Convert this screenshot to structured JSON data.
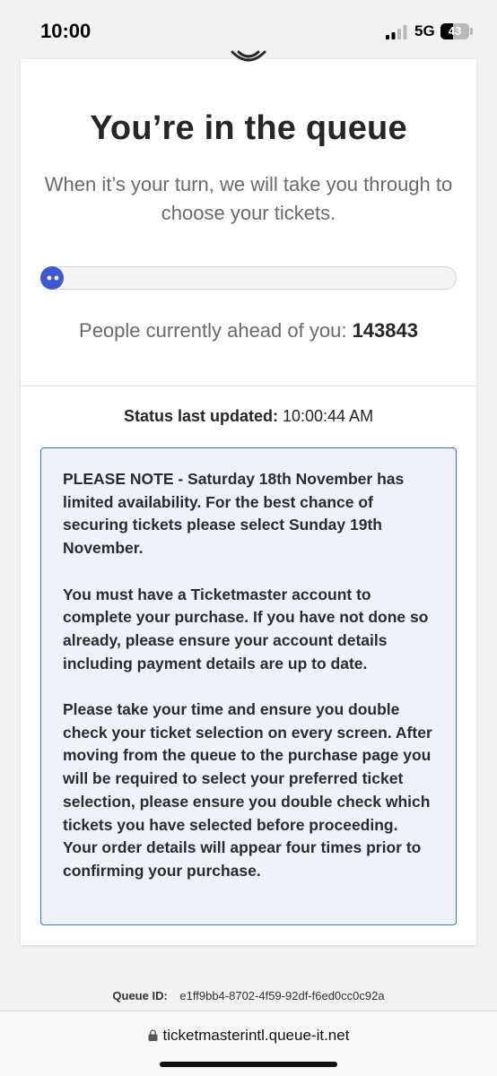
{
  "status_bar": {
    "time": "10:00",
    "network": "5G",
    "battery": "43",
    "battery_level": 0.43
  },
  "queue": {
    "title": "You’re in the queue",
    "subtitle": "When it’s your turn, we will take you through to choose your tickets.",
    "progress_percent": 0,
    "ahead_label": "People currently ahead of you:",
    "ahead_count": "143843",
    "status_label": "Status last updated:",
    "status_time": "10:00:44 AM"
  },
  "notice": {
    "paragraphs": [
      "PLEASE NOTE - Saturday 18th November has limited availability. For the best chance of securing tickets please select Sunday 19th November.",
      "You must have a Ticketmaster account to complete your purchase. If you have not done so already, please ensure your account details including payment details are up to date.",
      "Please take your time and ensure you double check your ticket selection on every screen. After moving from the queue to the purchase page you will be required to select your preferred ticket selection, please ensure you double check which tickets you have selected before proceeding. Your order details will appear four times prior to confirming your purchase."
    ]
  },
  "footer": {
    "queue_id_label": "Queue ID:",
    "queue_id": "e1ff9bb4-8702-4f59-92df-f6ed0cc0c92a"
  },
  "browser": {
    "url": "ticketmasterintl.queue-it.net"
  },
  "colors": {
    "accent": "#3f58d3",
    "notice_border": "#3f6fd6",
    "notice_bg": "#eef3fa"
  }
}
